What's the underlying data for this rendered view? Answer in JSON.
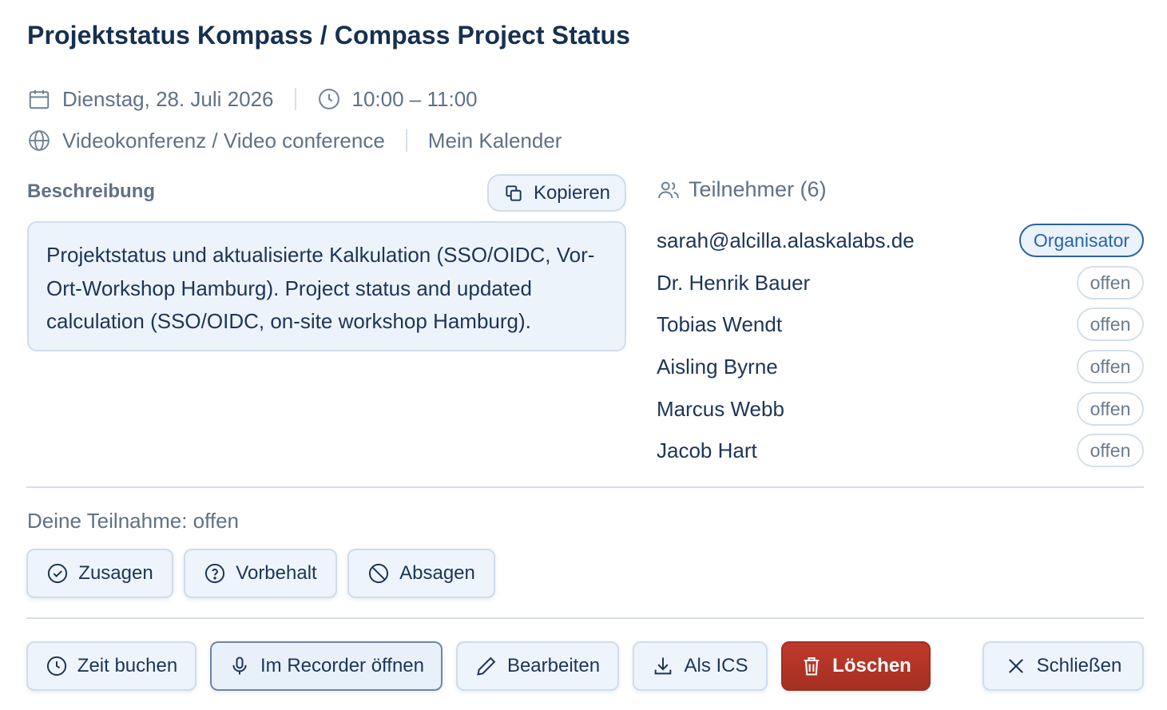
{
  "title": "Projektstatus Kompass / Compass Project Status",
  "meta": {
    "date": "Dienstag, 28. Juli 2026",
    "time": "10:00 – 11:00",
    "location": "Videokonferenz / Video conference",
    "calendar": "Mein Kalender"
  },
  "description": {
    "label": "Beschreibung",
    "copy_label": "Kopieren",
    "text": "Projektstatus und aktualisierte Kalkulation (SSO/OIDC, Vor-Ort-Workshop Hamburg). Project status and updated calculation (SSO/OIDC, on-site workshop Hamburg)."
  },
  "participants": {
    "header": "Teilnehmer (6)",
    "list": [
      {
        "name": "sarah@alcilla.alaskalabs.de",
        "status": "Organisator"
      },
      {
        "name": "Dr. Henrik Bauer",
        "status": "offen"
      },
      {
        "name": "Tobias Wendt",
        "status": "offen"
      },
      {
        "name": "Aisling Byrne",
        "status": "offen"
      },
      {
        "name": "Marcus Webb",
        "status": "offen"
      },
      {
        "name": "Jacob Hart",
        "status": "offen"
      }
    ]
  },
  "rsvp": {
    "label": "Deine Teilnahme: offen",
    "accept": "Zusagen",
    "tentative": "Vorbehalt",
    "decline": "Absagen"
  },
  "actions": {
    "book_time": "Zeit buchen",
    "open_recorder": "Im Recorder öffnen",
    "edit": "Bearbeiten",
    "ics": "Als ICS",
    "delete": "Löschen",
    "close": "Schließen"
  },
  "colors": {
    "title": "#163050",
    "accent": "#2a63a6",
    "danger": "#b03426",
    "muted": "#5f7187"
  }
}
